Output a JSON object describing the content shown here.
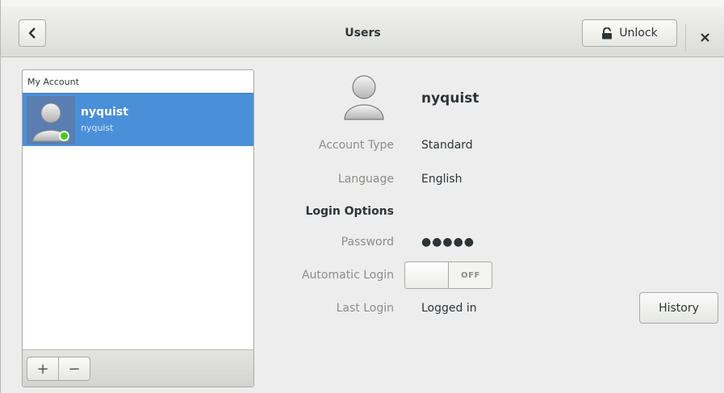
{
  "header": {
    "title": "Users",
    "back_icon": "chevron-left-icon",
    "unlock_label": "Unlock",
    "unlock_icon": "lock-icon",
    "close_icon": "close-icon"
  },
  "user_list": {
    "section_label": "My Account",
    "users": [
      {
        "name": "nyquist",
        "login": "nyquist",
        "status_color": "#4ec32a",
        "selected": true
      }
    ],
    "add_label": "+",
    "remove_label": "−"
  },
  "details": {
    "name": "nyquist",
    "account_type_label": "Account Type",
    "account_type_value": "Standard",
    "language_label": "Language",
    "language_value": "English",
    "login_options_label": "Login Options",
    "password_label": "Password",
    "password_value": "●●●●●",
    "automatic_login_label": "Automatic Login",
    "automatic_login_state": "OFF",
    "last_login_label": "Last Login",
    "last_login_value": "Logged in",
    "history_label": "History"
  },
  "colors": {
    "selection": "#4a90d9",
    "status_online": "#4ec32a"
  }
}
